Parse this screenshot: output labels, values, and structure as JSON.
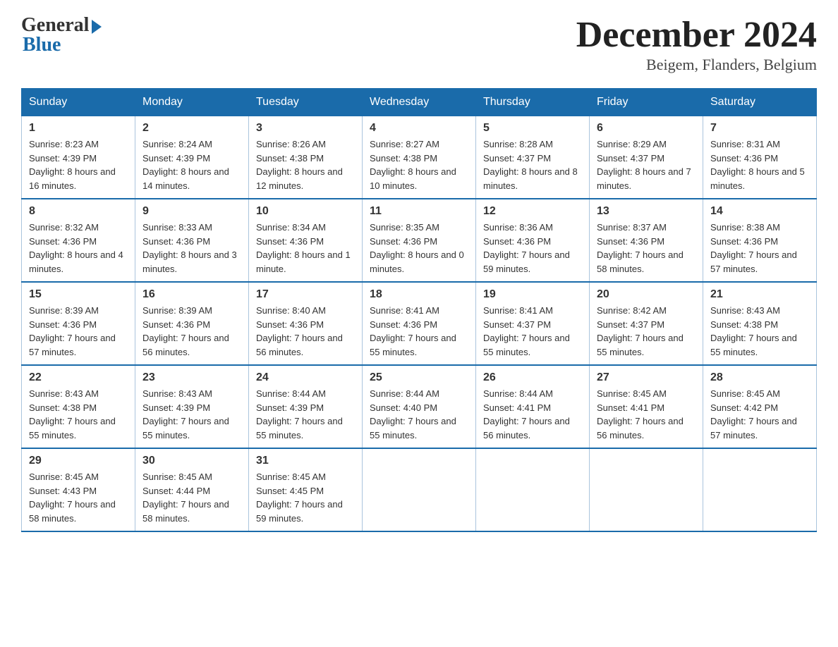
{
  "header": {
    "logo_general": "General",
    "logo_blue": "Blue",
    "month_title": "December 2024",
    "location": "Beigem, Flanders, Belgium"
  },
  "weekdays": [
    "Sunday",
    "Monday",
    "Tuesday",
    "Wednesday",
    "Thursday",
    "Friday",
    "Saturday"
  ],
  "weeks": [
    [
      {
        "day": "1",
        "sunrise": "8:23 AM",
        "sunset": "4:39 PM",
        "daylight": "8 hours and 16 minutes."
      },
      {
        "day": "2",
        "sunrise": "8:24 AM",
        "sunset": "4:39 PM",
        "daylight": "8 hours and 14 minutes."
      },
      {
        "day": "3",
        "sunrise": "8:26 AM",
        "sunset": "4:38 PM",
        "daylight": "8 hours and 12 minutes."
      },
      {
        "day": "4",
        "sunrise": "8:27 AM",
        "sunset": "4:38 PM",
        "daylight": "8 hours and 10 minutes."
      },
      {
        "day": "5",
        "sunrise": "8:28 AM",
        "sunset": "4:37 PM",
        "daylight": "8 hours and 8 minutes."
      },
      {
        "day": "6",
        "sunrise": "8:29 AM",
        "sunset": "4:37 PM",
        "daylight": "8 hours and 7 minutes."
      },
      {
        "day": "7",
        "sunrise": "8:31 AM",
        "sunset": "4:36 PM",
        "daylight": "8 hours and 5 minutes."
      }
    ],
    [
      {
        "day": "8",
        "sunrise": "8:32 AM",
        "sunset": "4:36 PM",
        "daylight": "8 hours and 4 minutes."
      },
      {
        "day": "9",
        "sunrise": "8:33 AM",
        "sunset": "4:36 PM",
        "daylight": "8 hours and 3 minutes."
      },
      {
        "day": "10",
        "sunrise": "8:34 AM",
        "sunset": "4:36 PM",
        "daylight": "8 hours and 1 minute."
      },
      {
        "day": "11",
        "sunrise": "8:35 AM",
        "sunset": "4:36 PM",
        "daylight": "8 hours and 0 minutes."
      },
      {
        "day": "12",
        "sunrise": "8:36 AM",
        "sunset": "4:36 PM",
        "daylight": "7 hours and 59 minutes."
      },
      {
        "day": "13",
        "sunrise": "8:37 AM",
        "sunset": "4:36 PM",
        "daylight": "7 hours and 58 minutes."
      },
      {
        "day": "14",
        "sunrise": "8:38 AM",
        "sunset": "4:36 PM",
        "daylight": "7 hours and 57 minutes."
      }
    ],
    [
      {
        "day": "15",
        "sunrise": "8:39 AM",
        "sunset": "4:36 PM",
        "daylight": "7 hours and 57 minutes."
      },
      {
        "day": "16",
        "sunrise": "8:39 AM",
        "sunset": "4:36 PM",
        "daylight": "7 hours and 56 minutes."
      },
      {
        "day": "17",
        "sunrise": "8:40 AM",
        "sunset": "4:36 PM",
        "daylight": "7 hours and 56 minutes."
      },
      {
        "day": "18",
        "sunrise": "8:41 AM",
        "sunset": "4:36 PM",
        "daylight": "7 hours and 55 minutes."
      },
      {
        "day": "19",
        "sunrise": "8:41 AM",
        "sunset": "4:37 PM",
        "daylight": "7 hours and 55 minutes."
      },
      {
        "day": "20",
        "sunrise": "8:42 AM",
        "sunset": "4:37 PM",
        "daylight": "7 hours and 55 minutes."
      },
      {
        "day": "21",
        "sunrise": "8:43 AM",
        "sunset": "4:38 PM",
        "daylight": "7 hours and 55 minutes."
      }
    ],
    [
      {
        "day": "22",
        "sunrise": "8:43 AM",
        "sunset": "4:38 PM",
        "daylight": "7 hours and 55 minutes."
      },
      {
        "day": "23",
        "sunrise": "8:43 AM",
        "sunset": "4:39 PM",
        "daylight": "7 hours and 55 minutes."
      },
      {
        "day": "24",
        "sunrise": "8:44 AM",
        "sunset": "4:39 PM",
        "daylight": "7 hours and 55 minutes."
      },
      {
        "day": "25",
        "sunrise": "8:44 AM",
        "sunset": "4:40 PM",
        "daylight": "7 hours and 55 minutes."
      },
      {
        "day": "26",
        "sunrise": "8:44 AM",
        "sunset": "4:41 PM",
        "daylight": "7 hours and 56 minutes."
      },
      {
        "day": "27",
        "sunrise": "8:45 AM",
        "sunset": "4:41 PM",
        "daylight": "7 hours and 56 minutes."
      },
      {
        "day": "28",
        "sunrise": "8:45 AM",
        "sunset": "4:42 PM",
        "daylight": "7 hours and 57 minutes."
      }
    ],
    [
      {
        "day": "29",
        "sunrise": "8:45 AM",
        "sunset": "4:43 PM",
        "daylight": "7 hours and 58 minutes."
      },
      {
        "day": "30",
        "sunrise": "8:45 AM",
        "sunset": "4:44 PM",
        "daylight": "7 hours and 58 minutes."
      },
      {
        "day": "31",
        "sunrise": "8:45 AM",
        "sunset": "4:45 PM",
        "daylight": "7 hours and 59 minutes."
      },
      null,
      null,
      null,
      null
    ]
  ],
  "labels": {
    "sunrise": "Sunrise:",
    "sunset": "Sunset:",
    "daylight": "Daylight:"
  }
}
